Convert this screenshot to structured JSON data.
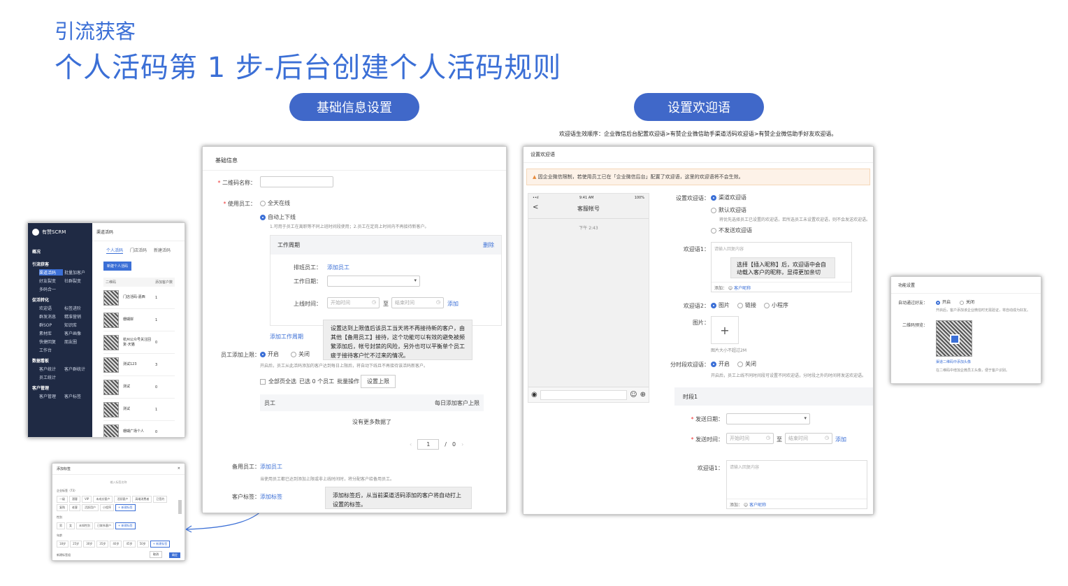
{
  "header": {
    "subtitle": "引流获客",
    "title": "个人活码第 1 步-后台创建个人活码规则"
  },
  "pills": {
    "left": "基础信息设置",
    "right": "设置欢迎语"
  },
  "welcome_order": "欢迎语生效顺序：企业微信后台配置欢迎语>有赞企业微信助手渠道活码欢迎语>有赞企业微信助手好友欢迎语。",
  "crm": {
    "brand": "有赞SCRM",
    "page": "渠道活码",
    "tabs": [
      "个人活码",
      "门店活码",
      "新建活码"
    ],
    "new_btn": "新建个人活码",
    "cols": [
      "二维码",
      "添加客户数"
    ],
    "rows": [
      {
        "name": "门店活码-嘉西",
        "count": "1"
      },
      {
        "name": "珊瑚岸",
        "count": "1"
      },
      {
        "name": "杭州公众号关注回复-天猫",
        "count": "0"
      },
      {
        "name": "测试123",
        "count": "3"
      },
      {
        "name": "测试",
        "count": "0"
      },
      {
        "name": "测试",
        "count": "1"
      },
      {
        "name": "珊瑚广场个人",
        "count": "0"
      }
    ],
    "nav": [
      {
        "group": "概况",
        "items": []
      },
      {
        "group": "引流获客",
        "items": [
          "渠道活码",
          "批量加客户",
          "好友裂变",
          "社群裂变",
          "多码合一"
        ]
      },
      {
        "group": "促活转化",
        "items": [
          "欢迎语",
          "标签进阶",
          "群发消息",
          "精准营销",
          "群SOP",
          "知识库",
          "素材库",
          "客户画像",
          "快捷回复",
          "朋友圈",
          "工作台"
        ]
      },
      {
        "group": "数据看板",
        "items": [
          "客户统计",
          "客户群统计",
          "员工统计"
        ]
      },
      {
        "group": "客户管理",
        "items": [
          "客户管理",
          "客户标签"
        ]
      }
    ]
  },
  "tag_dialog": {
    "title": "添加标签",
    "close": "×",
    "search": "输入标签名称",
    "group1": "企业标签（73）",
    "tags1": [
      "一级",
      "潜客",
      "VIP",
      "未成交客户",
      "活跃客户",
      "高端消费者",
      "已签约",
      "复购",
      "老客",
      "活跃用户",
      "小程序",
      "+ 新建标签"
    ],
    "group2": "性别",
    "tags2": [
      "男",
      "女",
      "未知性别",
      "已联系客户",
      "+ 新建标签"
    ],
    "group3": "年龄",
    "tags3": [
      "18岁",
      "25岁",
      "30岁",
      "35岁",
      "40岁",
      "45岁",
      "50岁",
      "+ 新建标签"
    ],
    "create": "新建标签组",
    "cancel": "取消",
    "confirm": "确定"
  },
  "basic": {
    "section": "基础信息",
    "name_label": "二维码名称：",
    "staff_label": "使用员工：",
    "opt_all": "全天在线",
    "opt_auto": "自动上下线",
    "auto_hint": "1.可用于员工在离职等不同上班时间段使用；2.员工在定岗上时间内不再接待新客户。",
    "cycle_title": "工作周期",
    "cycle_del": "删除",
    "shift_label": "排班员工：",
    "shift_add": "添加员工",
    "date_label": "工作日期：",
    "time_label": "上线时间：",
    "start_ph": "开始时间",
    "to": "至",
    "end_ph": "结束时间",
    "time_add": "添加",
    "add_cycle": "添加工作周期",
    "limit_label": "员工添加上限：",
    "limit_on": "开启",
    "limit_off": "关闭",
    "limit_hint": "开启后，员工从此活码添加的客户达到每日上限后，将自动下线且不再接待该活码新客户。",
    "select_all": "全部页全选",
    "selected": "已选 0 个员工",
    "batch": "批量操作",
    "set_limit": "设置上限",
    "tbl_staff": "员工",
    "tbl_limit": "每日添加客户上限",
    "no_data": "没有更多数据了",
    "page_num": "1",
    "page_sep": "/",
    "page_total": "0",
    "backup_label": "备用员工：",
    "backup_add": "添加员工",
    "backup_hint": "当使用员工都已达到添加上限或非上线时间时，将分配客户给备用员工。",
    "tag_label": "客户标签：",
    "tag_add": "添加标签",
    "callout1": "设置达到上限值后该员工当天将不再接待新的客户，由其他【备用员工】接待，这个功能可以有效的避免被频繁添加后，帐号封禁的风险，另外也可以平衡单个员工疲于接待客户忙不过来的情况。",
    "callout2": "添加标签后，从当前渠道活码添加的客户将自动打上设置的标签。"
  },
  "welcome": {
    "section": "设置欢迎语",
    "warn": "因企业微信限制，若使用员工已在「企业微信后台」配置了欢迎语，这里的欢迎语将不会生效。",
    "phone": {
      "signal": "••ıl",
      "time": "9:41 AM",
      "battery": "100%",
      "back": "<",
      "name": "客服帐号",
      "chat_time": "下午 2:43"
    },
    "set_label": "设置欢迎语：",
    "opt1": "渠道欢迎语",
    "opt2": "默认欢迎语",
    "opt2_hint": "将优先选择员工已设置的欢迎语，若所选员工未设置欢迎语，则不会发送欢迎语。",
    "opt3": "不发送欢迎语",
    "msg1_label": "欢迎语1：",
    "msg1_ph": "请输入回复内容",
    "insert_label": "添加：",
    "insert_name": "客户昵称",
    "callout": "选择【插入昵称】后，欢迎语中会自动载入客户的昵称，显得更加亲切",
    "msg2_label": "欢迎语2：",
    "m2_opt1": "图片",
    "m2_opt2": "链接",
    "m2_opt3": "小程序",
    "img_label": "图片：",
    "img_plus": "+",
    "img_hint": "图片大小不超过2M",
    "period_label": "分时段欢迎语：",
    "period_on": "开启",
    "period_off": "关闭",
    "period_hint": "开启后，员工上线不同时间段可设置不同欢迎语，分时段之外的时间将发送欢迎语。",
    "slot": "时段1",
    "date_label": "发送日期：",
    "time_label": "发送时间：",
    "start_ph": "开始时间",
    "to": "至",
    "end_ph": "结束时间",
    "time_add": "添加",
    "msg_label": "欢迎语1：",
    "msg_ph": "请输入回复内容",
    "insert2_label": "添加：",
    "insert2_name": "客户昵称"
  },
  "func": {
    "title": "功能设置",
    "auto_label": "自动通过好友：",
    "on": "开启",
    "off": "关闭",
    "auto_hint": "开启后，客户添加该企业微信时无需验证，将自动成为好友。",
    "qr_label": "二维码预览：",
    "qr_link": "渠道二维码中添加头像",
    "qr_hint": "在二维码中增加企微员工头像，便于客户识别。"
  },
  "colors": {
    "accent": "#3b6fd6",
    "pill": "#4068c9",
    "sidebar": "#1f2a44",
    "warn_bg": "#fdf2e8"
  }
}
